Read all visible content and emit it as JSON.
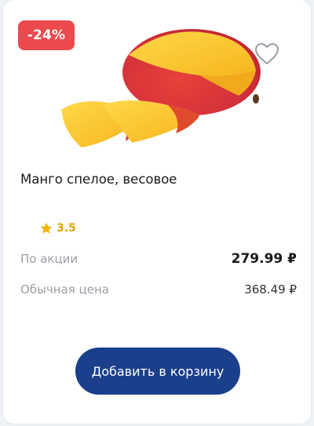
{
  "product": {
    "discount_badge": "-24%",
    "name": "Манго спелое, весовое",
    "rating": "3.5",
    "promo_label": "По акции",
    "promo_price": "279.99 ₽",
    "regular_label": "Обычная цена",
    "regular_price": "368.49 ₽",
    "add_to_cart_label": "Добавить в корзину",
    "image_icon": "mango-image",
    "favorite_icon": "heart-outline-icon",
    "rating_icon": "star-icon"
  },
  "colors": {
    "badge": "#ec4a4f",
    "button": "#1a3f8b",
    "star": "#f5b400"
  }
}
